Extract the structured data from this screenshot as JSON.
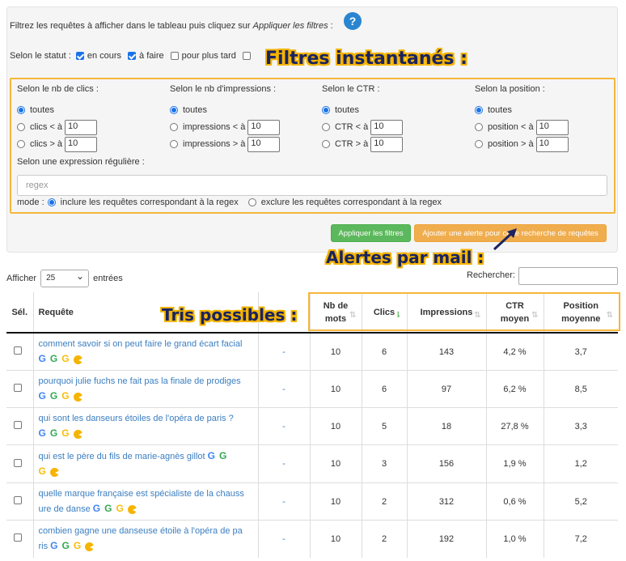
{
  "intro": {
    "text": "Filtrez les requêtes à afficher dans le tableau puis cliquez sur ",
    "emphasis": "Appliquer les filtres",
    "suffix": " :",
    "help_icon": "?"
  },
  "status": {
    "label": "Selon le statut :",
    "options": [
      {
        "label": "en cours",
        "checked": true
      },
      {
        "label": "à faire",
        "checked": true
      },
      {
        "label": "pour plus tard",
        "checked": false
      }
    ]
  },
  "annotations": {
    "filters": "Filtres instantanés :",
    "alerts": "Alertes par mail :",
    "sorts": "Tris possibles :"
  },
  "filters": {
    "clicks": {
      "head": "Selon le nb de clics :",
      "all": "toutes",
      "lt": "clics < à",
      "gt": "clics > à",
      "lt_val": "10",
      "gt_val": "10"
    },
    "impressions": {
      "head": "Selon le nb d'impressions :",
      "all": "toutes",
      "lt": "impressions < à",
      "gt": "impressions > à",
      "lt_val": "10",
      "gt_val": "10"
    },
    "ctr": {
      "head": "Selon le CTR :",
      "all": "toutes",
      "lt": "CTR < à",
      "gt": "CTR > à",
      "lt_val": "10",
      "gt_val": "10"
    },
    "position": {
      "head": "Selon la position :",
      "all": "toutes",
      "lt": "position < à",
      "gt": "position > à",
      "lt_val": "10",
      "gt_val": "10"
    },
    "regex_label": "Selon une expression régulière :",
    "regex_placeholder": "regex",
    "mode_label": "mode :",
    "mode_include": "inclure les requêtes correspondant à la regex",
    "mode_exclude": "exclure les requêtes correspondant à la regex"
  },
  "buttons": {
    "apply": "Appliquer les filtres",
    "alert": "Ajouter une alerte pour cette recherche de requêtes"
  },
  "controls": {
    "show_label": "Afficher",
    "page_size": "25",
    "entries_label": "entrées",
    "search_label": "Rechercher:"
  },
  "table": {
    "headers": {
      "sel": "Sél.",
      "query": "Requête",
      "words": "Nb de mots",
      "clicks": "Clics",
      "impressions": "Impressions",
      "ctr": "CTR moyen",
      "position": "Position moyenne"
    },
    "rows": [
      {
        "query": "comment savoir si on peut faire le grand écart facial",
        "dash": "-",
        "words": "10",
        "clicks": "6",
        "impressions": "143",
        "ctr": "4,2 %",
        "position": "3,7"
      },
      {
        "query": "pourquoi julie fuchs ne fait pas la finale de prodiges",
        "dash": "-",
        "words": "10",
        "clicks": "6",
        "impressions": "97",
        "ctr": "6,2 %",
        "position": "8,5"
      },
      {
        "query": "qui sont les danseurs étoiles de l'opéra de paris ?",
        "dash": "-",
        "words": "10",
        "clicks": "5",
        "impressions": "18",
        "ctr": "27,8 %",
        "position": "3,3"
      },
      {
        "query": "qui est le père du fils de marie-agnès gillot",
        "dash": "-",
        "words": "10",
        "clicks": "3",
        "impressions": "156",
        "ctr": "1,9 %",
        "position": "1,2"
      },
      {
        "query": "quelle marque française est spécialiste de la chauss ure de danse",
        "dash": "-",
        "words": "10",
        "clicks": "2",
        "impressions": "312",
        "ctr": "0,6 %",
        "position": "5,2"
      },
      {
        "query": "combien gagne une danseuse étoile à l'opéra de pa ris",
        "dash": "-",
        "words": "10",
        "clicks": "2",
        "impressions": "192",
        "ctr": "1,0 %",
        "position": "7,2"
      }
    ]
  }
}
